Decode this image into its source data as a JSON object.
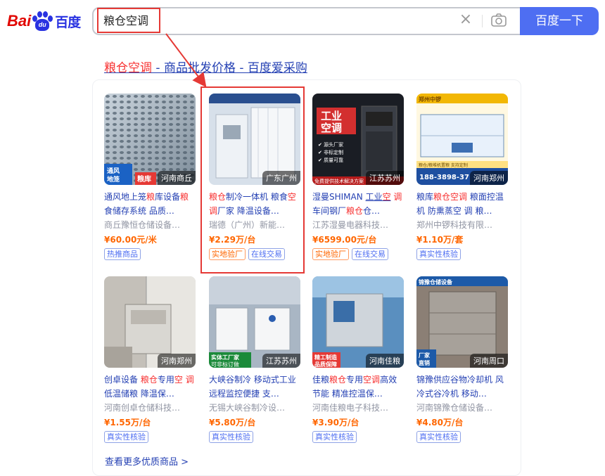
{
  "logo": {
    "part1": "Bai",
    "paw_text": "du",
    "part2": "百度"
  },
  "search": {
    "query": "粮仓空调",
    "button_label": "百度一下"
  },
  "result": {
    "title_em": "粮仓空调",
    "title_rest": " - 商品批发价格 - 百度爱采购"
  },
  "products": [
    {
      "title_html": "通风地上笼<span class=\"em\">粮</span>库设备<span class=\"em\">粮</span>食储存系统 品质…",
      "shop": "商丘豫恒仓储设备…",
      "price": "¥60.00元/米",
      "badges": [
        {
          "text": "热推商品",
          "orange": false
        }
      ],
      "location": "河南商丘",
      "tag": "通风地笼",
      "img": "perforated"
    },
    {
      "title_html": "<span class=\"em\">粮仓</span>制冷一体机 粮食<span class=\"em\">空调</span>厂家 降温设备…",
      "shop": "瑞德（广州）新能…",
      "price": "¥2.29万/台",
      "badges": [
        {
          "text": "实地验厂",
          "orange": true
        },
        {
          "text": "在线交易",
          "orange": false
        }
      ],
      "location": "广东广州",
      "tag": "瑞德新能源",
      "img": "unit_white"
    },
    {
      "title_html": "湿曼SHIMAN <span style=\"text-decoration:underline\">工业<span class=\"em\">空</span></span> <span class=\"em\">调</span> 车间钢厂<span class=\"em\">粮仓</span>仓…",
      "shop": "江苏湿曼电器科技…",
      "price": "¥6599.00元/台",
      "badges": [
        {
          "text": "实地验厂",
          "orange": true
        },
        {
          "text": "在线交易",
          "orange": false
        }
      ],
      "location": "江苏苏州",
      "tag": "工业空调",
      "img": "red_ac"
    },
    {
      "title_html": "粮库<span class=\"em\">粮仓空调</span> 粮面控温机 防熏蒸空 调 粮…",
      "shop": "郑州中锣科技有限…",
      "price": "¥1.10万/套",
      "badges": [
        {
          "text": "真实性核验",
          "orange": false
        }
      ],
      "location": "河南郑州",
      "tag": "郑州中锣",
      "img": "diagram"
    },
    {
      "title_html": "创卓设备 <span class=\"em\">粮仓</span>专用<span class=\"em\">空</span> <span class=\"em\">调</span> 低温储粮 降温保…",
      "shop": "河南创卓仓储科技…",
      "price": "¥1.55万/台",
      "badges": [
        {
          "text": "真实性核验",
          "orange": false
        }
      ],
      "location": "河南郑州",
      "tag": "",
      "img": "wall_unit"
    },
    {
      "title_html": "大峡谷制冷 移动式工业 远程监控便捷 支…",
      "shop": "无锡大峡谷制冷设…",
      "price": "¥5.80万/台",
      "badges": [
        {
          "text": "真实性核验",
          "orange": false
        }
      ],
      "location": "江苏苏州",
      "tag": "实体工厂家",
      "img": "white_units"
    },
    {
      "title_html": "佳粮<span class=\"em\">粮仓</span>专用<span class=\"em\">空调</span>高效节能 精准控温保…",
      "shop": "河南佳粮电子科技…",
      "price": "¥3.90万/台",
      "badges": [
        {
          "text": "真实性核验",
          "orange": false
        }
      ],
      "location": "河南佳粮",
      "tag": "精工制造",
      "img": "steel_unit"
    },
    {
      "title_html": "锦豫供应谷物冷却机 风冷式谷冷机 移动…",
      "shop": "河南锦豫仓储设备…",
      "price": "¥4.80万/台",
      "badges": [
        {
          "text": "真实性核验",
          "orange": false
        }
      ],
      "location": "河南周口",
      "tag": "锦豫仓储设备",
      "img": "cooler"
    }
  ],
  "more_label": "查看更多优质商品 >"
}
